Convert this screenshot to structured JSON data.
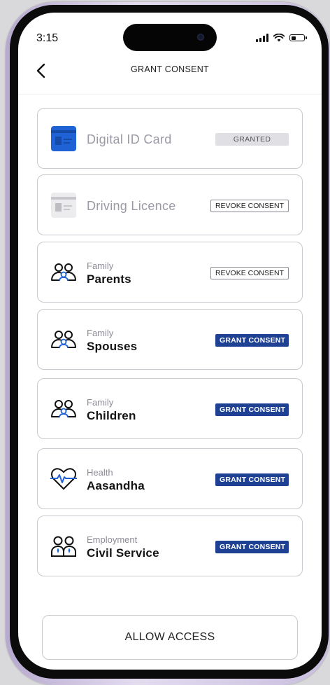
{
  "status_bar": {
    "time": "3:15",
    "icons": [
      "signal-icon",
      "wifi-icon",
      "battery-icon"
    ]
  },
  "header": {
    "back_icon": "chevron-left-icon",
    "title": "GRANT CONSENT"
  },
  "documents": [
    {
      "name": "Digital ID Card",
      "icon": "id-card-icon",
      "action": "GRANTED",
      "state": "granted"
    },
    {
      "name": "Driving Licence",
      "icon": "license-card-icon",
      "action": "REVOKE CONSENT",
      "state": "revoke"
    }
  ],
  "consents": [
    {
      "category": "Family",
      "name": "Parents",
      "icon": "family-people-icon",
      "action": "REVOKE CONSENT",
      "state": "revoke"
    },
    {
      "category": "Family",
      "name": "Spouses",
      "icon": "family-people-icon",
      "action": "GRANT CONSENT",
      "state": "grant"
    },
    {
      "category": "Family",
      "name": "Children",
      "icon": "family-people-icon",
      "action": "GRANT CONSENT",
      "state": "grant"
    },
    {
      "category": "Health",
      "name": "Aasandha",
      "icon": "heart-pulse-icon",
      "action": "GRANT CONSENT",
      "state": "grant"
    },
    {
      "category": "Employment",
      "name": "Civil Service",
      "icon": "employees-icon",
      "action": "GRANT CONSENT",
      "state": "grant"
    }
  ],
  "footer": {
    "allow_access_label": "ALLOW ACCESS"
  },
  "colors": {
    "accent": "#1f4193",
    "granted_badge": "#e0e0e4",
    "card_border": "#c9c9cf",
    "icon_blue": "#1f62d6"
  }
}
